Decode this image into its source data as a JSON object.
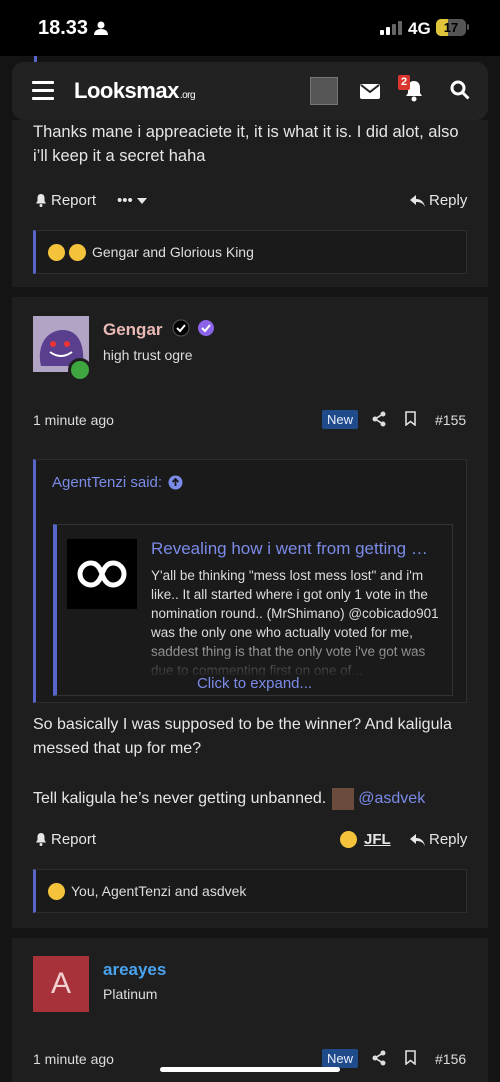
{
  "status_bar": {
    "time": "18.33",
    "network": "4G",
    "battery": "17"
  },
  "nav": {
    "logo_main": "Looksmax",
    "logo_suffix": ".org",
    "notification_count": "2"
  },
  "post1": {
    "text": "Thanks mane i appreaciete it, it is what it is. I did alot, also i’ll keep it a secret haha",
    "report_label": "Report",
    "more_label": "•••",
    "reply_label": "Reply",
    "reactions_text": "Gengar and Glorious King"
  },
  "post2": {
    "username": "Gengar",
    "user_title": "high trust ogre",
    "time": "1 minute ago",
    "new_badge": "New",
    "post_number": "#155",
    "quote": {
      "author_said": "AgentTenzi said:",
      "embed_title": "Revealing how i went from getting …",
      "embed_body": "Y'all be thinking \"mess lost mess lost\" and i'm like.. It all started where i got only 1 vote in the nomination round.. (MrShimano) @cobicado901 was the only one who actually voted for me, saddest thing is that the only vote i've got was due to commenting first on one of...",
      "expand_label": "Click to expand..."
    },
    "paragraph1": "So basically I was supposed to be the winner? And kaligula messed that up for me?",
    "paragraph2": "Tell kaligula he’s never getting unbanned.",
    "mention": "@asdvek",
    "report_label": "Report",
    "reaction_user": "JFL",
    "reply_label": "Reply",
    "reactions_text": "You, AgentTenzi and asdvek"
  },
  "post3": {
    "avatar_letter": "A",
    "username": "areayes",
    "user_title": "Platinum",
    "time": "1 minute ago",
    "new_badge": "New",
    "post_number": "#156"
  },
  "colors": {
    "accent": "#5865c9",
    "link": "#7b8be8",
    "username_blue": "#4aa3f0",
    "new_badge": "#1f4b8a",
    "avatar_red": "#a8323a"
  }
}
